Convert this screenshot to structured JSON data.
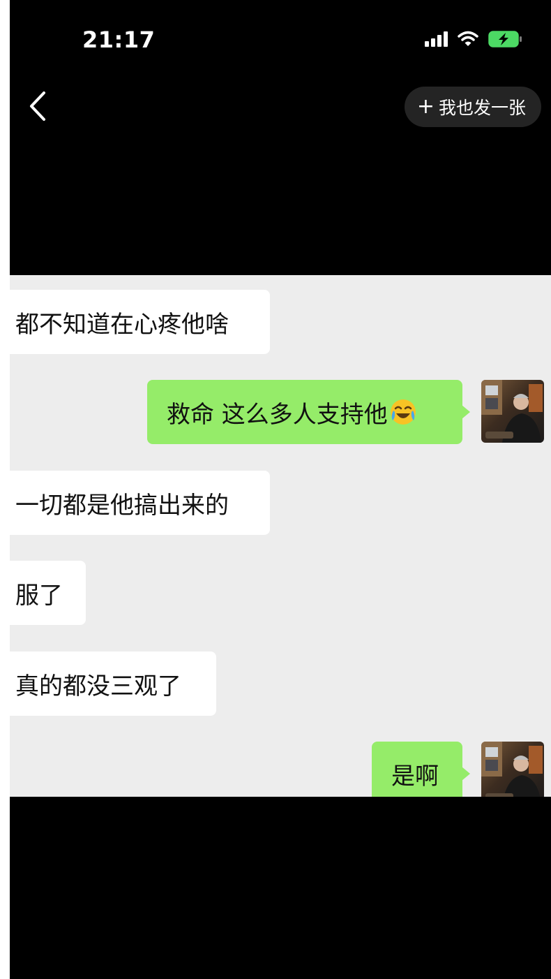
{
  "status_bar": {
    "time": "21:17",
    "icons": [
      "cellular-signal-icon",
      "wifi-icon",
      "battery-charging-icon"
    ],
    "battery_color": "#4cd964"
  },
  "nav": {
    "back_icon": "chevron-left-icon",
    "post_button": {
      "plus": "+",
      "label": "我也发一张"
    }
  },
  "chat": {
    "background": "#ededed",
    "incoming_bubble_color": "#ffffff",
    "outgoing_bubble_color": "#95ec69",
    "messages": [
      {
        "side": "left",
        "text": "都不知道在心疼他啥"
      },
      {
        "side": "right",
        "text": "救命 这么多人支持他",
        "emoji": "crying-laughing-emoji"
      },
      {
        "side": "left",
        "text": "一切都是他搞出来的"
      },
      {
        "side": "left",
        "text": "服了"
      },
      {
        "side": "left",
        "text": "真的都没三观了"
      },
      {
        "side": "right",
        "text": "是啊"
      }
    ]
  }
}
